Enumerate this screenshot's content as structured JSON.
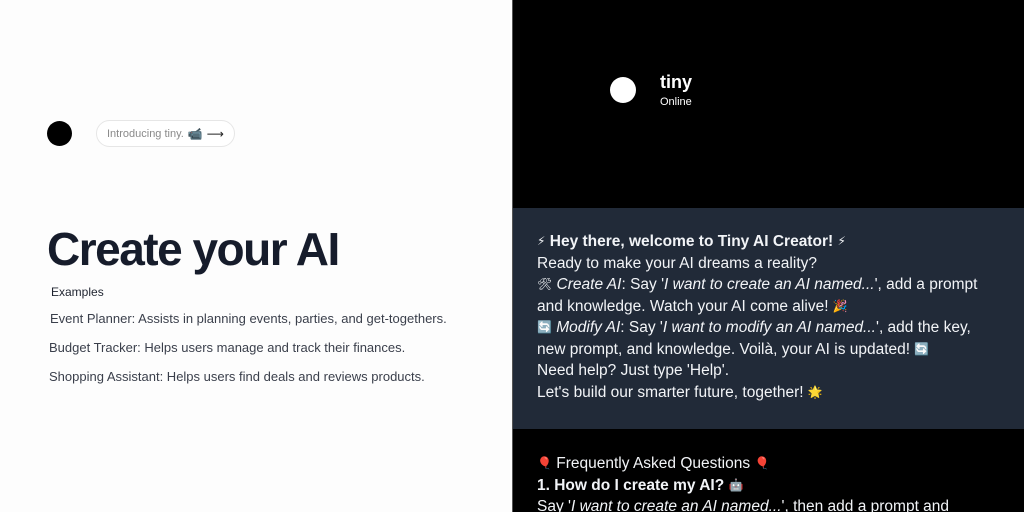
{
  "left": {
    "intro_pill": "Introducing tiny.",
    "intro_pill_icon": "video-camera-icon",
    "intro_arrow": "⟶",
    "title": "Create your AI",
    "examples_label": "Examples",
    "examples": [
      "Event Planner: Assists in planning events, parties, and get-togethers.",
      "Budget Tracker: Helps users manage and track their finances.",
      "Shopping Assistant: Helps users find deals and reviews products."
    ]
  },
  "chat": {
    "bot_name": "tiny",
    "bot_status": "Online",
    "welcome": {
      "greeting": "Hey there, welcome to Tiny AI Creator!",
      "line2": "Ready to make your AI dreams a reality?",
      "create_label": "Create AI",
      "create_say": ": Say '",
      "create_phrase": "I want to create an AI named...",
      "create_rest": "', add a prompt",
      "create_line2": "and knowledge. Watch your AI come alive!",
      "modify_label": "Modify AI",
      "modify_say": ": Say '",
      "modify_phrase": "I want to modify an AI named...",
      "modify_rest": "', add the key,",
      "modify_line2": "new prompt, and knowledge. Voilà, your AI is updated!",
      "help": "Need help? Just type 'Help'.",
      "closing": "Let's build our smarter future, together!"
    },
    "faq": {
      "heading": "Frequently Asked Questions",
      "q1": "1. How do I create my AI?",
      "a1_start": "Say '",
      "a1_phrase": "I want to create an AI named...",
      "a1_rest": "', then add a prompt and"
    }
  },
  "colors": {
    "title": "#161c2b",
    "chat_bg": "#000000",
    "welcome_bg": "#212a38",
    "chat_text": "#f2f4f7"
  },
  "icons": [
    "lightning-icon",
    "tools-icon",
    "refresh-icon",
    "party-popper-icon",
    "sparkle-icon",
    "balloon-icon",
    "robot-icon"
  ]
}
